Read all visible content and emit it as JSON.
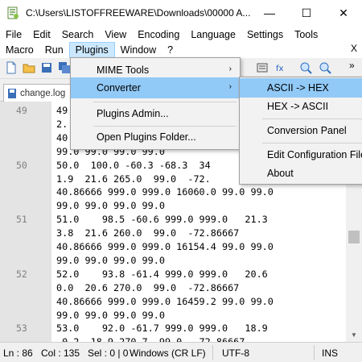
{
  "window": {
    "title": "C:\\Users\\LISTOFFREEWARE\\Downloads\\00000 A...",
    "minimize_glyph": "—",
    "maximize_glyph": "☐",
    "close_glyph": "✕"
  },
  "menubar": {
    "row1": [
      "File",
      "Edit",
      "Search",
      "View",
      "Encoding",
      "Language",
      "Settings",
      "Tools"
    ],
    "row2": [
      "Macro",
      "Run",
      "Plugins",
      "Window",
      "?"
    ],
    "close_glyph": "X"
  },
  "toolbar": {
    "overflow_glyph": "»"
  },
  "tabs": [
    {
      "label": "change.log"
    }
  ],
  "editor": {
    "lines": [
      {
        "num": "49",
        "text": "49"
      },
      {
        "num": "",
        "text": "2."
      },
      {
        "num": "",
        "text": "40"
      },
      {
        "num": "",
        "text": "99.0 99.0 99.0 99.0"
      },
      {
        "num": "50",
        "text": "50.0  100.0 -60.3 -68.3  34"
      },
      {
        "num": "",
        "text": "1.9  21.6 265.0  99.0  -72."
      },
      {
        "num": "",
        "text": "40.86666 999.0 999.0 16060.0 99.0 99.0"
      },
      {
        "num": "",
        "text": "99.0 99.0 99.0 99.0"
      },
      {
        "num": "51",
        "text": "51.0    98.5 -60.6 999.0 999.0   21.3"
      },
      {
        "num": "",
        "text": "3.8  21.6 260.0  99.0  -72.86667"
      },
      {
        "num": "",
        "text": "40.86666 999.0 999.0 16154.4 99.0 99.0"
      },
      {
        "num": "",
        "text": "99.0 99.0 99.0 99.0"
      },
      {
        "num": "52",
        "text": "52.0    93.8 -61.4 999.0 999.0   20.6"
      },
      {
        "num": "",
        "text": "0.0  20.6 270.0  99.0  -72.86667"
      },
      {
        "num": "",
        "text": "40.86666 999.0 999.0 16459.2 99.0 99.0"
      },
      {
        "num": "",
        "text": "99.0 99.0 99.0 99.0"
      },
      {
        "num": "53",
        "text": "53.0    92.0 -61.7 999.0 999.0   18.9"
      },
      {
        "num": "",
        "text": "-0.2  18.9 270.7  99.0  -72.86667"
      }
    ]
  },
  "plugins_menu": {
    "items": [
      {
        "label": "MIME Tools",
        "submenu": true
      },
      {
        "label": "Converter",
        "submenu": true,
        "highlighted": true
      },
      {
        "label": "Plugins Admin..."
      },
      {
        "label": "Open Plugins Folder..."
      }
    ],
    "arrow_glyph": "›"
  },
  "converter_menu": {
    "items": [
      {
        "label": "ASCII -> HEX",
        "highlighted": true
      },
      {
        "label": "HEX -> ASCII"
      },
      {
        "label": "Conversion Panel"
      },
      {
        "label": "Edit Configuration File"
      },
      {
        "label": "About"
      }
    ]
  },
  "statusbar": {
    "line": "Ln : 86",
    "col": "Col : 135",
    "sel": "Sel : 0 | 0",
    "eol": "Windows (CR LF)",
    "encoding": "UTF-8",
    "mode": "INS"
  },
  "colors": {
    "highlight": "#91c9f7",
    "active_menu": "#cce8ff",
    "gutter": "#e4e4e4"
  }
}
